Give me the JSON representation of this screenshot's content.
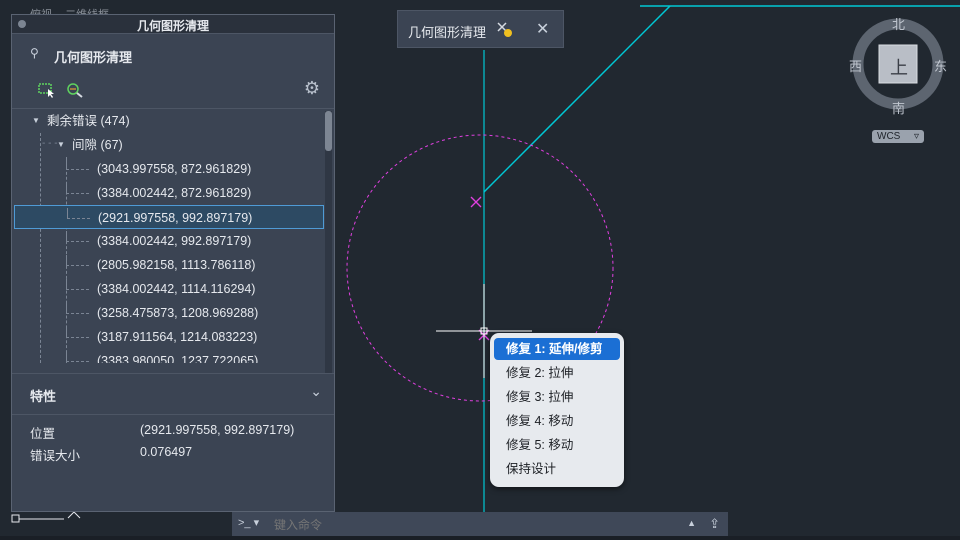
{
  "canvas_top_tabs": [
    "俯视",
    "二维线框"
  ],
  "palette": {
    "title": "几何图形清理",
    "header": "几何图形清理",
    "tree": {
      "root_label": "剩余错误 (474)",
      "group_label": "间隙 (67)",
      "items": [
        "(3043.997558, 872.961829)",
        "(3384.002442, 872.961829)",
        "(2921.997558, 992.897179)",
        "(3384.002442, 992.897179)",
        "(2805.982158, 1113.786118)",
        "(3384.002442, 1114.116294)",
        "(3258.475873, 1208.969288)",
        "(3187.911564, 1214.083223)",
        "(3383.980050, 1237.722065)"
      ],
      "selected_index": 2
    },
    "properties": {
      "title": "特性",
      "position_label": "位置",
      "position_value": "(2921.997558, 992.897179)",
      "size_label": "错误大小",
      "size_value": "0.076497"
    }
  },
  "floating_toolbar": {
    "title": "几何图形清理"
  },
  "context_menu": {
    "items": [
      "修复 1: 延伸/修剪",
      "修复 2: 拉伸",
      "修复 3: 拉伸",
      "修复 4: 移动",
      "修复 5: 移动",
      "保持设计"
    ],
    "highlighted_index": 0
  },
  "viewcube": {
    "north": "北",
    "south": "南",
    "east": "东",
    "west": "西",
    "face": "上",
    "wcs": "WCS"
  },
  "command_line": {
    "prompt": ">_",
    "placeholder": "键入命令"
  },
  "colors": {
    "cyan_line": "#00c8d4",
    "magenta": "#e040e0",
    "accent": "#1b6fd4",
    "selection_border": "#4f9bd6"
  }
}
